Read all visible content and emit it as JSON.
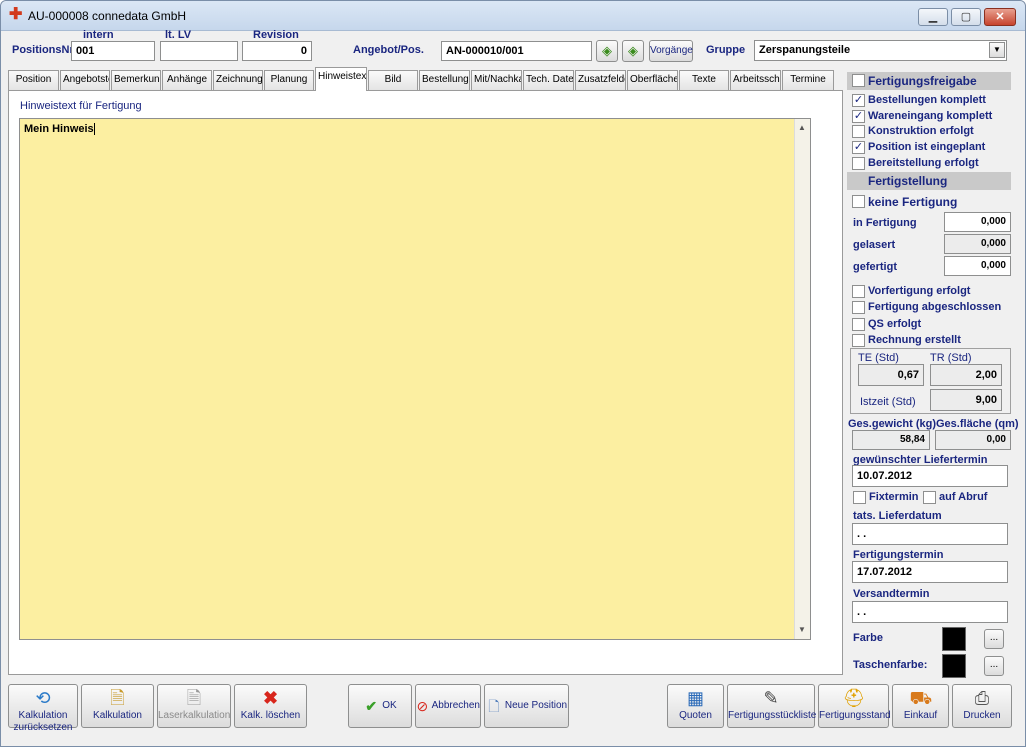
{
  "window": {
    "title": "AU-000008 connedata GmbH"
  },
  "header": {
    "positionsnr_label": "PositionsNr",
    "positionsnr_value": "001",
    "intern_label": "intern",
    "intern_value": "",
    "lt_lv_label": "lt. LV",
    "lt_lv_value": "",
    "revision_label": "Revision",
    "revision_value": "0",
    "angebot_label": "Angebot/Pos.",
    "angebot_value": "AN-000010/001",
    "vorgaenge_label": "Vorgänge",
    "gruppe_label": "Gruppe",
    "gruppe_value": "Zerspanungsteile"
  },
  "tabs": [
    "Position",
    "Angebotste",
    "Bemerkung",
    "Anhänge",
    "Zeichnungs",
    "Planung",
    "Hinweistex",
    "Bild",
    "Bestellunge",
    "Mit/Nachka",
    "Tech. Date",
    "Zusatzfelde",
    "Oberfläche",
    "Texte",
    "Arbeitsschi",
    "Termine"
  ],
  "active_tab": "Hinweistex",
  "main": {
    "memo_label": "Hinweistext für Fertigung",
    "memo_text": "Mein Hinweis"
  },
  "right": {
    "fertigungsfreigabe_label": "Fertigungsfreigabe",
    "checks1": [
      {
        "label": "Bestellungen komplett",
        "checked": "✓"
      },
      {
        "label": "Wareneingang komplett",
        "checked": "✓"
      },
      {
        "label": "Konstruktion erfolgt",
        "checked": ""
      },
      {
        "label": "Position ist eingeplant",
        "checked": "✓"
      },
      {
        "label": "Bereitstellung erfolgt",
        "checked": ""
      }
    ],
    "fertigstellung_label": "Fertigstellung",
    "keine_fertigung_label": "keine Fertigung",
    "in_fertigung_label": "in Fertigung",
    "in_fertigung_value": "0,000",
    "gelasert_label": "gelasert",
    "gelasert_value": "0,000",
    "gefertigt_label": "gefertigt",
    "gefertigt_value": "0,000",
    "checks2": [
      {
        "label": "Vorfertigung erfolgt"
      },
      {
        "label": "Fertigung abgeschlossen"
      },
      {
        "label": "QS erfolgt"
      },
      {
        "label": "Rechnung erstellt"
      }
    ],
    "te_label": "TE (Std)",
    "te_value": "0,67",
    "tr_label": "TR (Std)",
    "tr_value": "2,00",
    "istzeit_label": "Istzeit (Std)",
    "istzeit_value": "9,00",
    "gesgewicht_label": "Ges.gewicht (kg)",
    "gesgewicht_value": "58,84",
    "gesflaeche_label": "Ges.fläche (qm)",
    "gesflaeche_value": "0,00",
    "liefertermin_label": "gewünschter Liefertermin",
    "liefertermin_value": "10.07.2012",
    "fixtermin_label": "Fixtermin",
    "aufabruf_label": "auf Abruf",
    "tats_label": "tats. Lieferdatum",
    "tats_value": ". .",
    "fertigungstermin_label": "Fertigungstermin",
    "fertigungstermin_value": "17.07.2012",
    "versandtermin_label": "Versandtermin",
    "versandtermin_value": ". .",
    "farbe_label": "Farbe",
    "taschenfarbe_label": "Taschenfarbe:",
    "dots": "..."
  },
  "buttons": {
    "kalk_zurueck": "Kalkulation zurücksetzen",
    "kalkulation": "Kalkulation",
    "laserkalk": "Laserkalkulation",
    "kalk_loeschen": "Kalk. löschen",
    "ok": "OK",
    "abbrechen": "Abbrechen",
    "neue_position": "Neue Position",
    "quoten": "Quoten",
    "fertigungsstueckliste": "Fertigungsstückliste",
    "fertigungsstand": "Fertigungsstand",
    "einkauf": "Einkauf",
    "drucken": "Drucken"
  },
  "colors": {
    "memo_bg": "#fcefa1",
    "label_blue": "#1a2680",
    "section_grey": "#c9c9c9"
  }
}
